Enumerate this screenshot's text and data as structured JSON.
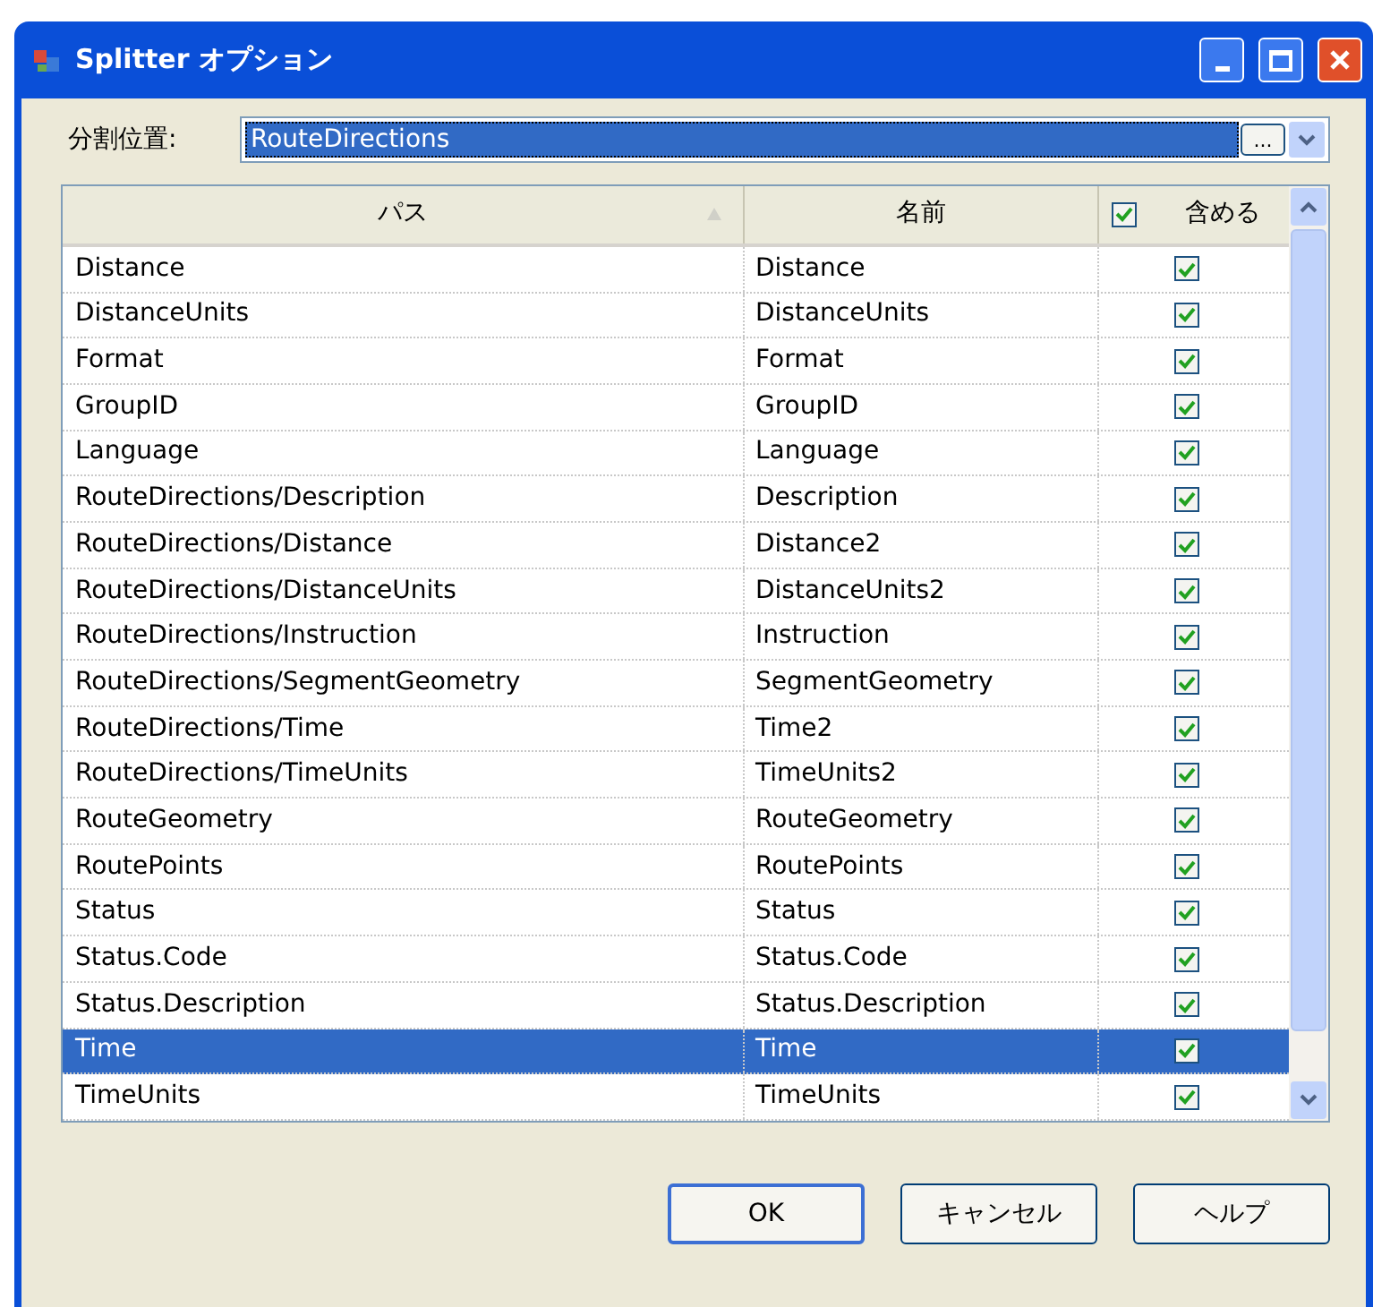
{
  "window": {
    "title": "Splitter オプション"
  },
  "split_position": {
    "label": "分割位置:",
    "value": "RouteDirections",
    "browse_button": "..."
  },
  "table": {
    "columns": [
      {
        "label": "パス"
      },
      {
        "label": "名前"
      },
      {
        "label": "含める",
        "checked": true
      }
    ],
    "rows": [
      {
        "path": "Distance",
        "name": "Distance",
        "include": true,
        "selected": false
      },
      {
        "path": "DistanceUnits",
        "name": "DistanceUnits",
        "include": true,
        "selected": false
      },
      {
        "path": "Format",
        "name": "Format",
        "include": true,
        "selected": false
      },
      {
        "path": "GroupID",
        "name": "GroupID",
        "include": true,
        "selected": false
      },
      {
        "path": "Language",
        "name": "Language",
        "include": true,
        "selected": false
      },
      {
        "path": "RouteDirections/Description",
        "name": "Description",
        "include": true,
        "selected": false
      },
      {
        "path": "RouteDirections/Distance",
        "name": "Distance2",
        "include": true,
        "selected": false
      },
      {
        "path": "RouteDirections/DistanceUnits",
        "name": "DistanceUnits2",
        "include": true,
        "selected": false
      },
      {
        "path": "RouteDirections/Instruction",
        "name": "Instruction",
        "include": true,
        "selected": false
      },
      {
        "path": "RouteDirections/SegmentGeometry",
        "name": "SegmentGeometry",
        "include": true,
        "selected": false
      },
      {
        "path": "RouteDirections/Time",
        "name": "Time2",
        "include": true,
        "selected": false
      },
      {
        "path": "RouteDirections/TimeUnits",
        "name": "TimeUnits2",
        "include": true,
        "selected": false
      },
      {
        "path": "RouteGeometry",
        "name": "RouteGeometry",
        "include": true,
        "selected": false
      },
      {
        "path": "RoutePoints",
        "name": "RoutePoints",
        "include": true,
        "selected": false
      },
      {
        "path": "Status",
        "name": "Status",
        "include": true,
        "selected": false
      },
      {
        "path": "Status.Code",
        "name": "Status.Code",
        "include": true,
        "selected": false
      },
      {
        "path": "Status.Description",
        "name": "Status.Description",
        "include": true,
        "selected": false
      },
      {
        "path": "Time",
        "name": "Time",
        "include": true,
        "selected": true
      },
      {
        "path": "TimeUnits",
        "name": "TimeUnits",
        "include": true,
        "selected": false
      }
    ]
  },
  "buttons": [
    "OK",
    "キャンセル",
    "ヘルプ"
  ]
}
